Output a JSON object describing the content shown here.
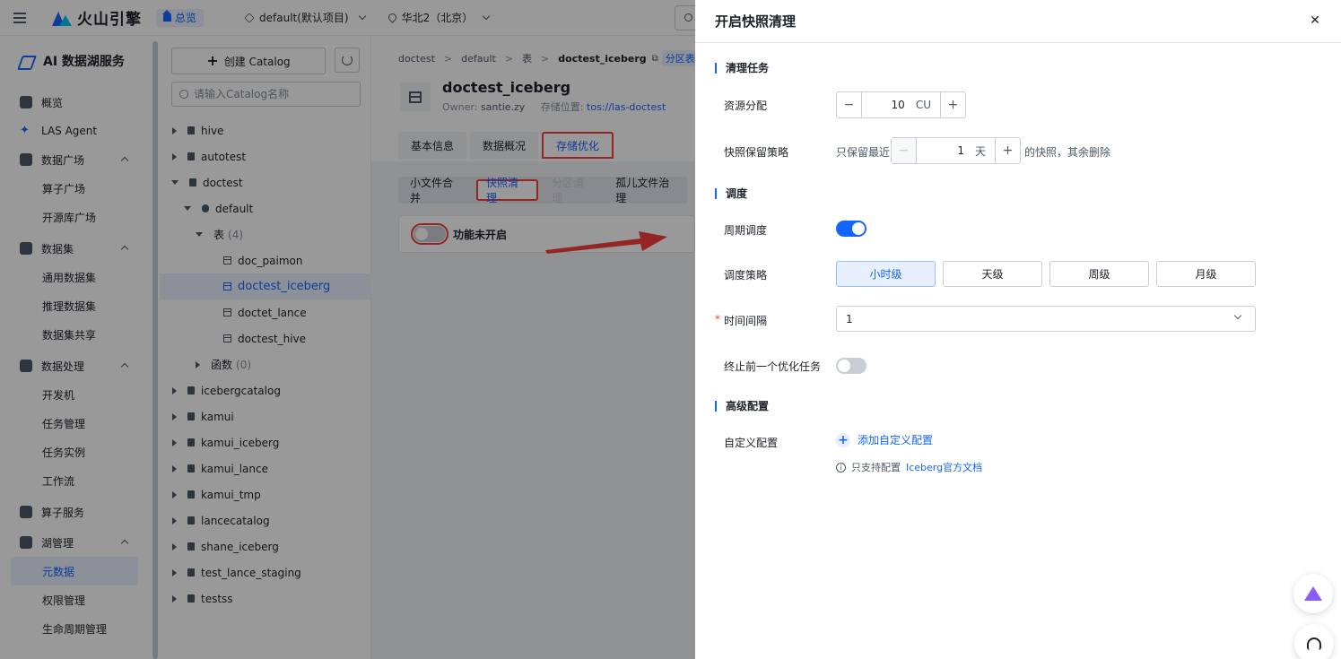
{
  "topbar": {
    "brand": "火山引擎",
    "home_label": "总览",
    "project": "default(默认项目)",
    "region": "华北2（北京）"
  },
  "leftnav": {
    "service": "AI 数据湖服务",
    "groups": [
      {
        "label": "概览"
      },
      {
        "label": "LAS Agent"
      },
      {
        "label": "数据广场",
        "items": [
          "算子广场",
          "开源库广场"
        ]
      },
      {
        "label": "数据集",
        "items": [
          "通用数据集",
          "推理数据集",
          "数据集共享"
        ]
      },
      {
        "label": "数据处理",
        "items": [
          "开发机",
          "任务管理",
          "任务实例",
          "工作流"
        ]
      },
      {
        "label": "算子服务"
      },
      {
        "label": "湖管理",
        "items": [
          "元数据",
          "权限管理",
          "生命周期管理"
        ]
      }
    ]
  },
  "catalog": {
    "create_label": "创建 Catalog",
    "search_placeholder": "请输入Catalog名称",
    "tree": {
      "hive": "hive",
      "autotest": "autotest",
      "doctest": "doctest",
      "default": "default",
      "tables_label": "表",
      "tables_count": "(4)",
      "tables": [
        "doc_paimon",
        "doctest_iceberg",
        "doctet_lance",
        "doctest_hive"
      ],
      "funcs_label": "函数",
      "funcs_count": "(0)",
      "rest": [
        "icebergcatalog",
        "kamui",
        "kamui_iceberg",
        "kamui_lance",
        "kamui_tmp",
        "lancecatalog",
        "shane_iceberg",
        "test_lance_staging",
        "testss"
      ]
    }
  },
  "main": {
    "breadcrumb": [
      "doctest",
      "default",
      "表",
      "doctest_iceberg"
    ],
    "breadcrumb_tag": "分区表",
    "table_name": "doctest_iceberg",
    "owner_label": "Owner:",
    "owner": "santie.zy",
    "storage_label": "存储位置:",
    "storage_link": "tos://las-doctest",
    "tabs": [
      "基本信息",
      "数据概况",
      "存储优化"
    ],
    "subtabs": [
      "小文件合并",
      "快照清理",
      "分区清理",
      "孤儿文件治理"
    ],
    "feature_status": "功能未开启"
  },
  "drawer": {
    "title": "开启快照清理",
    "sec_task": "清理任务",
    "resource_label": "资源分配",
    "resource_value": "10",
    "resource_unit": "CU",
    "retain_label": "快照保留策略",
    "retain_prefix": "只保留最近",
    "retain_value": "1",
    "retain_unit": "天",
    "retain_suffix": "的快照，其余删除",
    "sec_schedule": "调度",
    "periodic_label": "周期调度",
    "policy_label": "调度策略",
    "policy_options": [
      "小时级",
      "天级",
      "周级",
      "月级"
    ],
    "interval_label": "时间间隔",
    "interval_value": "1",
    "terminate_label": "终止前一个优化任务",
    "sec_advanced": "高级配置",
    "custom_label": "自定义配置",
    "add_custom": "添加自定义配置",
    "hint_text": "只支持配置",
    "hint_link": "Iceberg官方文档"
  }
}
